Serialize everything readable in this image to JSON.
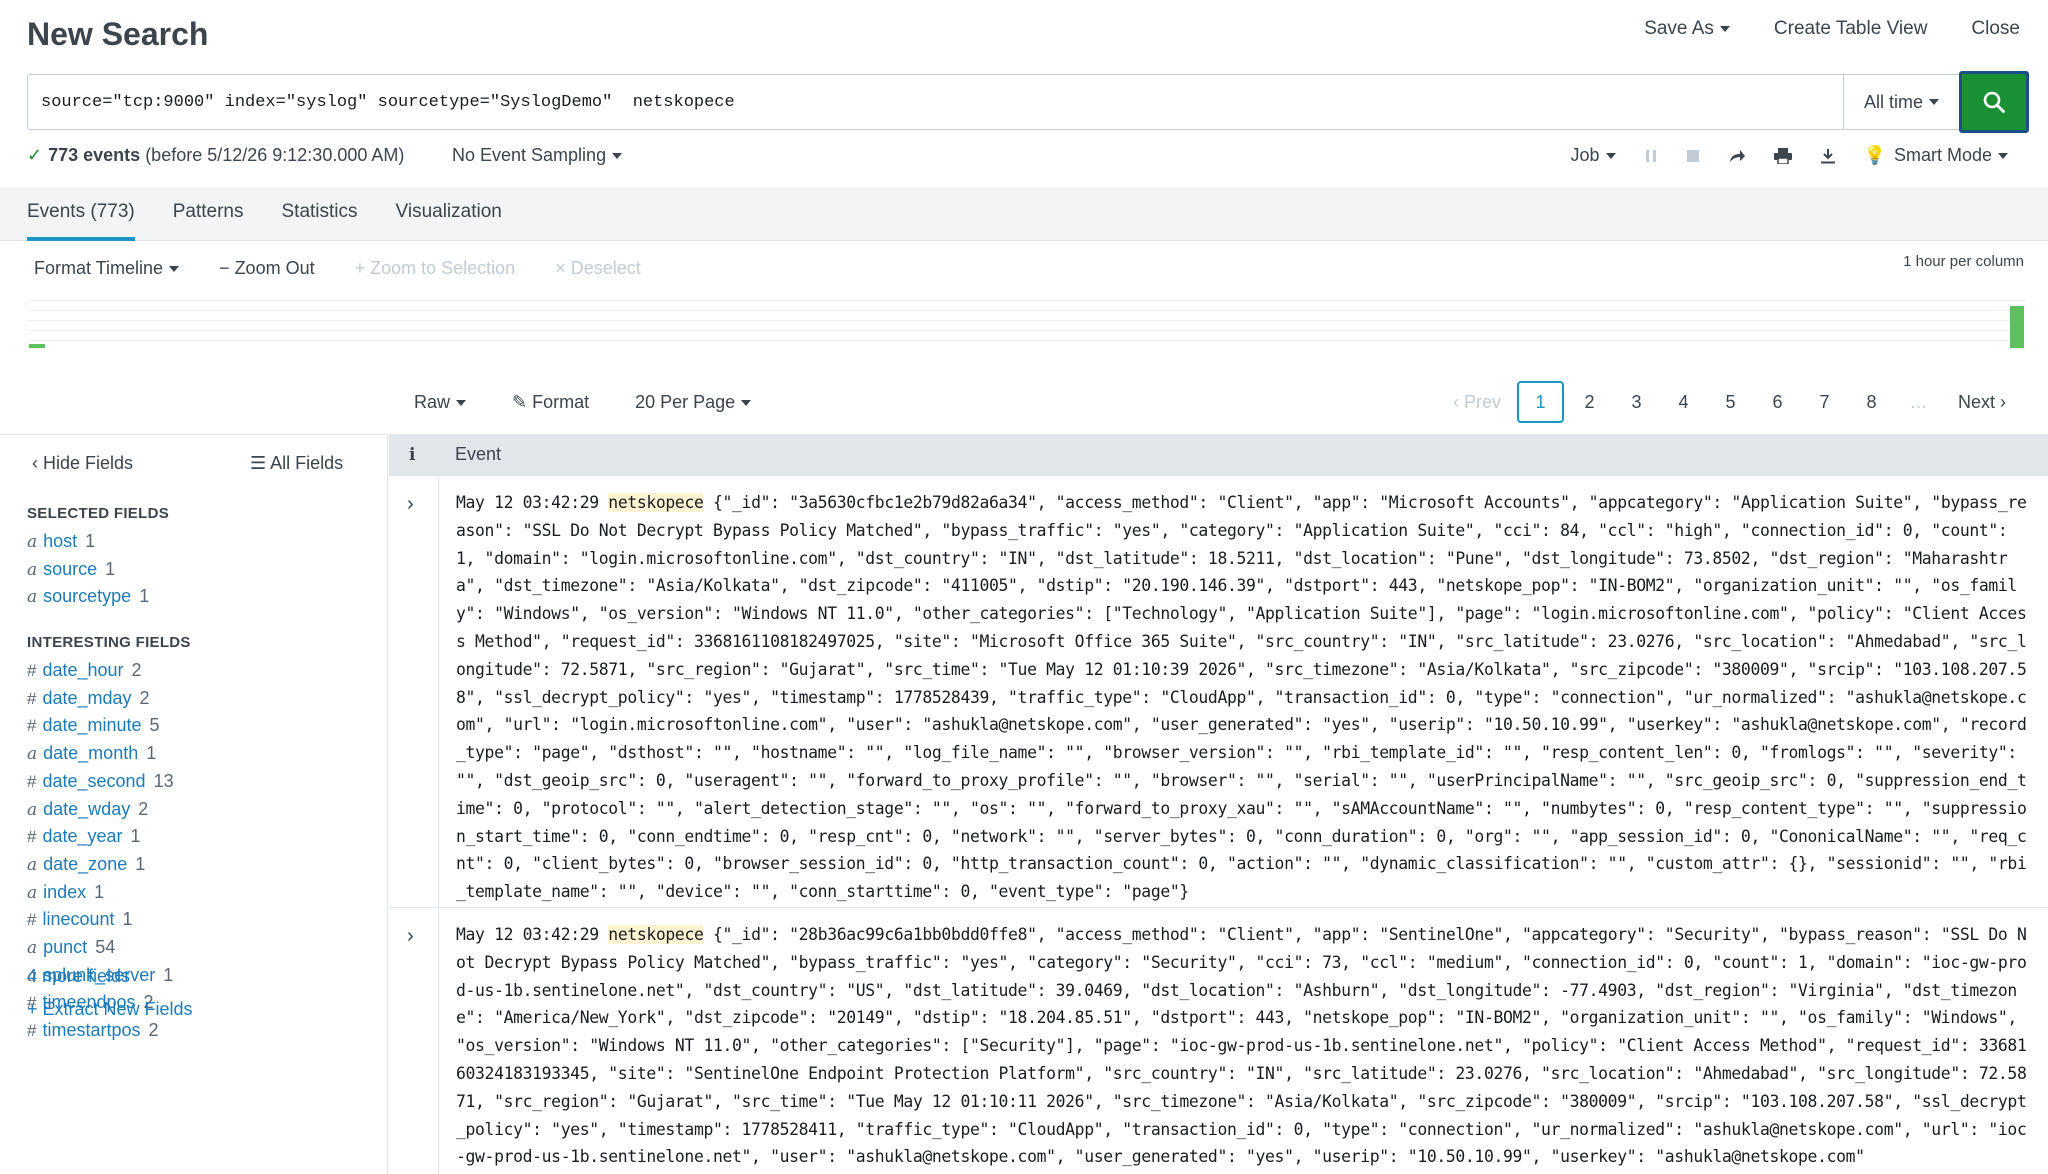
{
  "header": {
    "title": "New Search",
    "save_as": "Save As",
    "create_table_view": "Create Table View",
    "close": "Close"
  },
  "search": {
    "query": "source=\"tcp:9000\" index=\"syslog\" sourcetype=\"SyslogDemo\"  netskopece",
    "time_range": "All time"
  },
  "status": {
    "event_count": "773 events",
    "before": "(before 5/12/26 9:12:30.000 AM)",
    "sampling": "No Event Sampling",
    "job": "Job",
    "mode": "Smart Mode"
  },
  "tabs": [
    {
      "label": "Events (773)"
    },
    {
      "label": "Patterns"
    },
    {
      "label": "Statistics"
    },
    {
      "label": "Visualization"
    }
  ],
  "timeline": {
    "format": "Format Timeline",
    "zoom_out": "Zoom Out",
    "zoom_selection": "Zoom to Selection",
    "deselect": "Deselect",
    "scale": "1 hour per column"
  },
  "list": {
    "raw": "Raw",
    "format": "Format",
    "per_page": "20 Per Page"
  },
  "pager": {
    "prev": "Prev",
    "pages": [
      "1",
      "2",
      "3",
      "4",
      "5",
      "6",
      "7",
      "8"
    ],
    "ellipsis": "…",
    "next": "Next"
  },
  "sidebar": {
    "hide_fields": "Hide Fields",
    "all_fields": "All Fields",
    "selected_title": "SELECTED FIELDS",
    "selected": [
      {
        "type": "a",
        "name": "host",
        "count": "1"
      },
      {
        "type": "a",
        "name": "source",
        "count": "1"
      },
      {
        "type": "a",
        "name": "sourcetype",
        "count": "1"
      }
    ],
    "interesting_title": "INTERESTING FIELDS",
    "interesting": [
      {
        "type": "#",
        "name": "date_hour",
        "count": "2"
      },
      {
        "type": "#",
        "name": "date_mday",
        "count": "2"
      },
      {
        "type": "#",
        "name": "date_minute",
        "count": "5"
      },
      {
        "type": "a",
        "name": "date_month",
        "count": "1"
      },
      {
        "type": "#",
        "name": "date_second",
        "count": "13"
      },
      {
        "type": "a",
        "name": "date_wday",
        "count": "2"
      },
      {
        "type": "#",
        "name": "date_year",
        "count": "1"
      },
      {
        "type": "a",
        "name": "date_zone",
        "count": "1"
      },
      {
        "type": "a",
        "name": "index",
        "count": "1"
      },
      {
        "type": "#",
        "name": "linecount",
        "count": "1"
      },
      {
        "type": "a",
        "name": "punct",
        "count": "54"
      },
      {
        "type": "a",
        "name": "splunk_server",
        "count": "1"
      },
      {
        "type": "#",
        "name": "timeendpos",
        "count": "2"
      },
      {
        "type": "#",
        "name": "timestartpos",
        "count": "2"
      }
    ],
    "more_fields": "4 more fields",
    "extract": "+ Extract New Fields"
  },
  "events_table": {
    "info_col": "i",
    "event_col": "Event",
    "events": [
      {
        "time": "May 12 03:42:29 ",
        "highlight": "netskopece",
        "body": " {\"_id\": \"3a5630cfbc1e2b79d82a6a34\", \"access_method\": \"Client\", \"app\": \"Microsoft Accounts\", \"appcategory\": \"Application Suite\", \"bypass_reason\": \"SSL Do Not Decrypt Bypass Policy Matched\", \"bypass_traffic\": \"yes\", \"category\": \"Application Suite\", \"cci\": 84, \"ccl\": \"high\", \"connection_id\": 0, \"count\": 1, \"domain\": \"login.microsoftonline.com\", \"dst_country\": \"IN\", \"dst_latitude\": 18.5211, \"dst_location\": \"Pune\", \"dst_longitude\": 73.8502, \"dst_region\": \"Maharashtra\", \"dst_timezone\": \"Asia/Kolkata\", \"dst_zipcode\": \"411005\", \"dstip\": \"20.190.146.39\", \"dstport\": 443, \"netskope_pop\": \"IN-BOM2\", \"organization_unit\": \"\", \"os_family\": \"Windows\", \"os_version\": \"Windows NT 11.0\", \"other_categories\": [\"Technology\", \"Application Suite\"], \"page\": \"login.microsoftonline.com\", \"policy\": \"Client Access Method\", \"request_id\": 3368161108182497025, \"site\": \"Microsoft Office 365 Suite\", \"src_country\": \"IN\", \"src_latitude\": 23.0276, \"src_location\": \"Ahmedabad\", \"src_longitude\": 72.5871, \"src_region\": \"Gujarat\", \"src_time\": \"Tue May 12 01:10:39 2026\", \"src_timezone\": \"Asia/Kolkata\", \"src_zipcode\": \"380009\", \"srcip\": \"103.108.207.58\", \"ssl_decrypt_policy\": \"yes\", \"timestamp\": 1778528439, \"traffic_type\": \"CloudApp\", \"transaction_id\": 0, \"type\": \"connection\", \"ur_normalized\": \"ashukla@netskope.com\", \"url\": \"login.microsoftonline.com\", \"user\": \"ashukla@netskope.com\", \"user_generated\": \"yes\", \"userip\": \"10.50.10.99\", \"userkey\": \"ashukla@netskope.com\", \"record_type\": \"page\", \"dsthost\": \"\", \"hostname\": \"\", \"log_file_name\": \"\", \"browser_version\": \"\", \"rbi_template_id\": \"\", \"resp_content_len\": 0, \"fromlogs\": \"\", \"severity\": \"\", \"dst_geoip_src\": 0, \"useragent\": \"\", \"forward_to_proxy_profile\": \"\", \"browser\": \"\", \"serial\": \"\", \"userPrincipalName\": \"\", \"src_geoip_src\": 0, \"suppression_end_time\": 0, \"protocol\": \"\", \"alert_detection_stage\": \"\", \"os\": \"\", \"forward_to_proxy_xau\": \"\", \"sAMAccountName\": \"\", \"numbytes\": 0, \"resp_content_type\": \"\", \"suppression_start_time\": 0, \"conn_endtime\": 0, \"resp_cnt\": 0, \"network\": \"\", \"server_bytes\": 0, \"conn_duration\": 0, \"org\": \"\", \"app_session_id\": 0, \"CononicalName\": \"\", \"req_cnt\": 0, \"client_bytes\": 0, \"browser_session_id\": 0, \"http_transaction_count\": 0, \"action\": \"\", \"dynamic_classification\": \"\", \"custom_attr\": {}, \"sessionid\": \"\", \"rbi_template_name\": \"\", \"device\": \"\", \"conn_starttime\": 0, \"event_type\": \"page\"}"
      },
      {
        "time": "May 12 03:42:29 ",
        "highlight": "netskopece",
        "body": " {\"_id\": \"28b36ac99c6a1bb0bdd0ffe8\", \"access_method\": \"Client\", \"app\": \"SentinelOne\", \"appcategory\": \"Security\", \"bypass_reason\": \"SSL Do Not Decrypt Bypass Policy Matched\", \"bypass_traffic\": \"yes\", \"category\": \"Security\", \"cci\": 73, \"ccl\": \"medium\", \"connection_id\": 0, \"count\": 1, \"domain\": \"ioc-gw-prod-us-1b.sentinelone.net\", \"dst_country\": \"US\", \"dst_latitude\": 39.0469, \"dst_location\": \"Ashburn\", \"dst_longitude\": -77.4903, \"dst_region\": \"Virginia\", \"dst_timezone\": \"America/New_York\", \"dst_zipcode\": \"20149\", \"dstip\": \"18.204.85.51\", \"dstport\": 443, \"netskope_pop\": \"IN-BOM2\", \"organization_unit\": \"\", \"os_family\": \"Windows\", \"os_version\": \"Windows NT 11.0\", \"other_categories\": [\"Security\"], \"page\": \"ioc-gw-prod-us-1b.sentinelone.net\", \"policy\": \"Client Access Method\", \"request_id\": 3368160324183193345, \"site\": \"SentinelOne Endpoint Protection Platform\", \"src_country\": \"IN\", \"src_latitude\": 23.0276, \"src_location\": \"Ahmedabad\", \"src_longitude\": 72.5871, \"src_region\": \"Gujarat\", \"src_time\": \"Tue May 12 01:10:11 2026\", \"src_timezone\": \"Asia/Kolkata\", \"src_zipcode\": \"380009\", \"srcip\": \"103.108.207.58\", \"ssl_decrypt_policy\": \"yes\", \"timestamp\": 1778528411, \"traffic_type\": \"CloudApp\", \"transaction_id\": 0, \"type\": \"connection\", \"ur_normalized\": \"ashukla@netskope.com\", \"url\": \"ioc-gw-prod-us-1b.sentinelone.net\", \"user\": \"ashukla@netskope.com\", \"user_generated\": \"yes\", \"userip\": \"10.50.10.99\", \"userkey\": \"ashukla@netskope.com\""
      }
    ]
  },
  "colors": {
    "accent": "#1e93c6",
    "search_button": "#1a9035",
    "link": "#1e7ab8",
    "highlight": "#fdf3d2",
    "timeline_bar": "#5cc05c"
  }
}
